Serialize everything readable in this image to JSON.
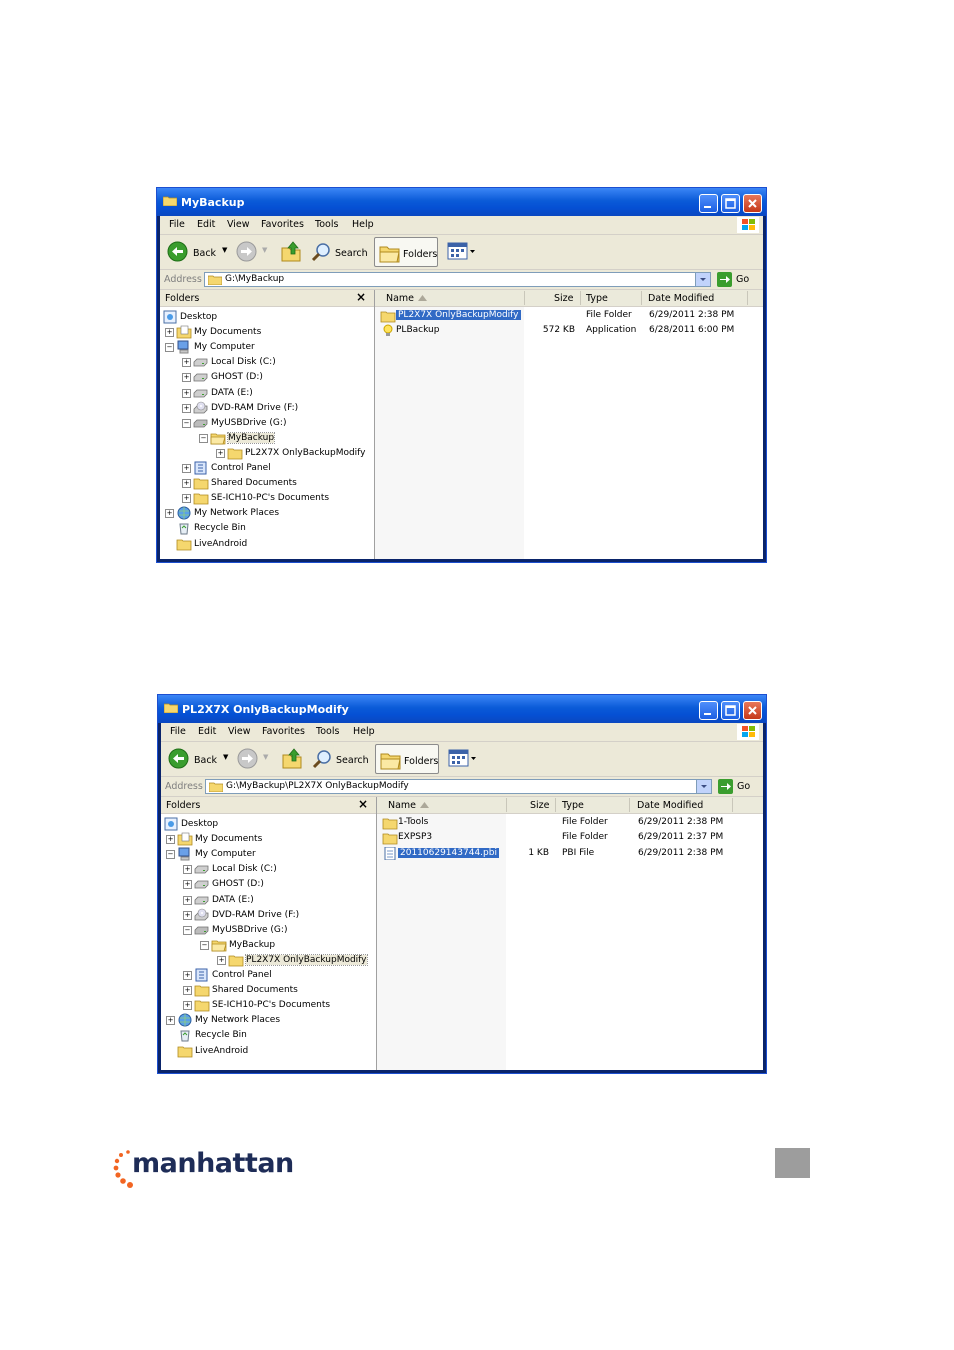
{
  "menus": [
    "File",
    "Edit",
    "View",
    "Favorites",
    "Tools",
    "Help"
  ],
  "toolbar": {
    "back": "Back",
    "search": "Search",
    "folders": "Folders"
  },
  "address": {
    "label": "Address",
    "go": "Go"
  },
  "folders_pane": {
    "title": "Folders"
  },
  "columns": {
    "name": "Name",
    "size": "Size",
    "type": "Type",
    "date": "Date Modified"
  },
  "tree": [
    {
      "label": "Desktop"
    },
    {
      "label": "My Documents"
    },
    {
      "label": "My Computer"
    },
    {
      "label": "Local Disk (C:)"
    },
    {
      "label": "GHOST (D:)"
    },
    {
      "label": "DATA (E:)"
    },
    {
      "label": "DVD-RAM Drive (F:)"
    },
    {
      "label": "MyUSBDrive (G:)"
    },
    {
      "label": "MyBackup"
    },
    {
      "label": "PL2X7X OnlyBackupModify"
    },
    {
      "label": "Control Panel"
    },
    {
      "label": "Shared Documents"
    },
    {
      "label": "SE-ICH10-PC's Documents"
    },
    {
      "label": "My Network Places"
    },
    {
      "label": "Recycle Bin"
    },
    {
      "label": "LiveAndroid"
    }
  ],
  "window1": {
    "title": "MyBackup",
    "address": "G:\\MyBackup",
    "files": [
      {
        "name": "PL2X7X OnlyBackupModify",
        "size": "",
        "type": "File Folder",
        "date": "6/29/2011 2:38 PM"
      },
      {
        "name": "PLBackup",
        "size": "572 KB",
        "type": "Application",
        "date": "6/28/2011 6:00 PM"
      }
    ]
  },
  "window2": {
    "title": "PL2X7X OnlyBackupModify",
    "address": "G:\\MyBackup\\PL2X7X OnlyBackupModify",
    "files": [
      {
        "name": "1-Tools",
        "size": "",
        "type": "File Folder",
        "date": "6/29/2011 2:38 PM"
      },
      {
        "name": "EXPSP3",
        "size": "",
        "type": "File Folder",
        "date": "6/29/2011 2:37 PM"
      },
      {
        "name": "20110629143744.pbi",
        "size": "1 KB",
        "type": "PBI File",
        "date": "6/29/2011 2:38 PM"
      }
    ]
  },
  "brand": {
    "name": "manhattan"
  },
  "colors": {
    "titlebar": "#0a5ad8",
    "selection": "#316ac5",
    "logo_text": "#1e2c57",
    "logo_dots": "#f26522"
  }
}
